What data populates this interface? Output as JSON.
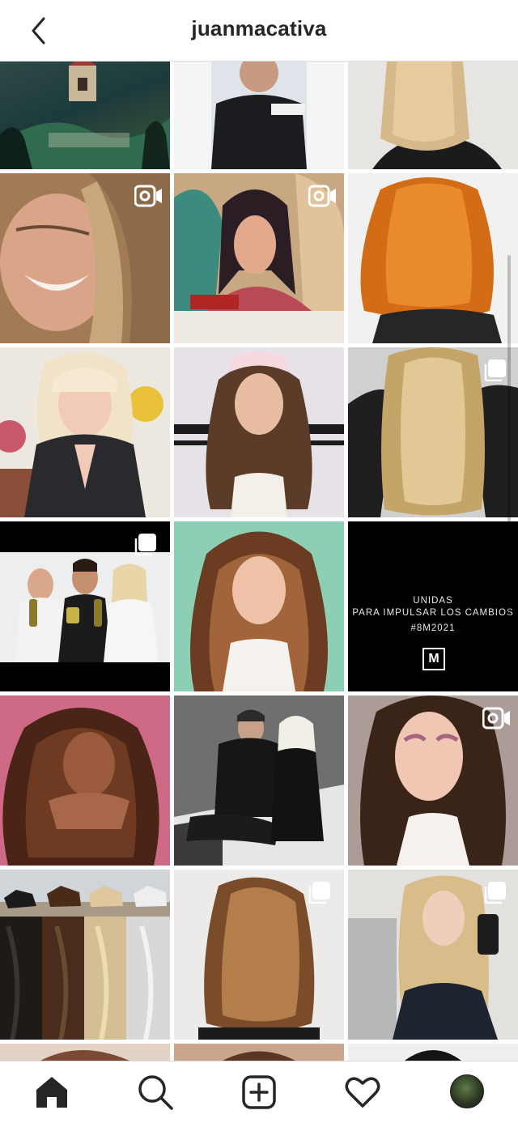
{
  "header": {
    "title": "juanmacativa",
    "back_icon": "chevron-left-icon"
  },
  "grid": {
    "posts": [
      {
        "id": "post-1",
        "badge": "none",
        "description": "book cover illustration"
      },
      {
        "id": "post-2",
        "badge": "none",
        "description": "man in black jacket"
      },
      {
        "id": "post-3",
        "badge": "none",
        "description": "blonde bob haircut"
      },
      {
        "id": "post-4",
        "badge": "igtv",
        "description": "smiling woman selfie"
      },
      {
        "id": "post-5",
        "badge": "igtv",
        "description": "pop art mural"
      },
      {
        "id": "post-6",
        "badge": "none",
        "description": "copper hair"
      },
      {
        "id": "post-7",
        "badge": "none",
        "description": "platinum bangs"
      },
      {
        "id": "post-8",
        "badge": "none",
        "description": "woman with headband"
      },
      {
        "id": "post-9",
        "badge": "carousel",
        "description": "blonde waves"
      },
      {
        "id": "post-10",
        "badge": "carousel",
        "description": "three people with products"
      },
      {
        "id": "post-11",
        "badge": "none",
        "description": "long brunette balayage"
      },
      {
        "id": "post-12",
        "badge": "none",
        "description": "text post",
        "text_lines": [
          "UNIDAS",
          "PARA IMPULSAR LOS CAMBIOS",
          "#8M2021"
        ],
        "logo_letter": "M"
      },
      {
        "id": "post-13",
        "badge": "none",
        "description": "curly brunette on pink"
      },
      {
        "id": "post-14",
        "badge": "none",
        "description": "couple studio photo"
      },
      {
        "id": "post-15",
        "badge": "igtv",
        "description": "woman makeup"
      },
      {
        "id": "post-16",
        "badge": "none",
        "description": "horse hair collage"
      },
      {
        "id": "post-17",
        "badge": "carousel",
        "description": "caramel blowout"
      },
      {
        "id": "post-18",
        "badge": "carousel",
        "description": "blonde selfie"
      }
    ]
  },
  "bottom_nav": {
    "items": [
      "home-icon",
      "search-icon",
      "new-post-icon",
      "activity-heart-icon",
      "profile-avatar"
    ],
    "active": "home-icon"
  },
  "colors": {
    "text": "#262626",
    "divider": "#dbdbdb",
    "background": "#ffffff"
  }
}
